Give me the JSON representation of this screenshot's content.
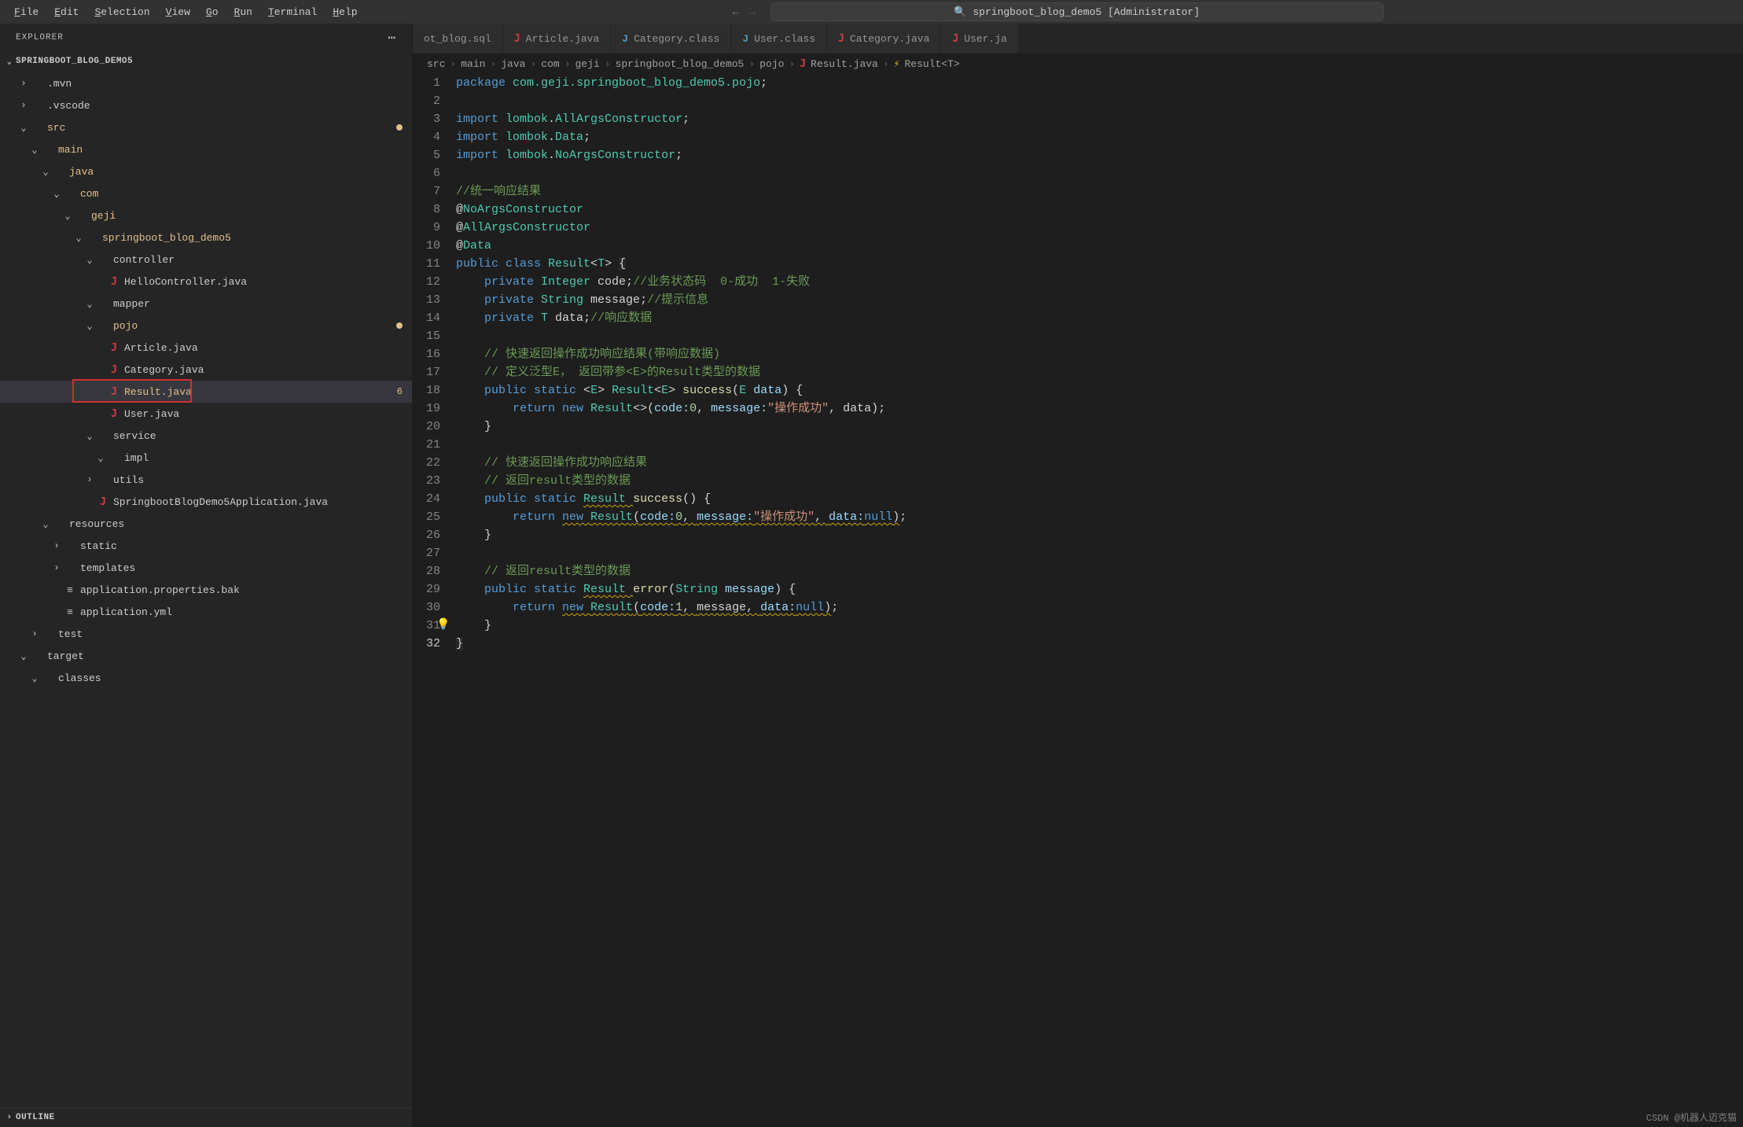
{
  "menubar": {
    "items": [
      {
        "pre": "",
        "mn": "F",
        "post": "ile"
      },
      {
        "pre": "",
        "mn": "E",
        "post": "dit"
      },
      {
        "pre": "",
        "mn": "S",
        "post": "election"
      },
      {
        "pre": "",
        "mn": "V",
        "post": "iew"
      },
      {
        "pre": "",
        "mn": "G",
        "post": "o"
      },
      {
        "pre": "",
        "mn": "R",
        "post": "un"
      },
      {
        "pre": "",
        "mn": "T",
        "post": "erminal"
      },
      {
        "pre": "",
        "mn": "H",
        "post": "elp"
      }
    ],
    "search_text": "springboot_blog_demo5 [Administrator]"
  },
  "explorer": {
    "title": "EXPLORER",
    "project": "SPRINGBOOT_BLOG_DEMO5",
    "outline": "OUTLINE",
    "tree": [
      {
        "indent": 1,
        "chev": "›",
        "label": ".mvn",
        "kind": "dir"
      },
      {
        "indent": 1,
        "chev": "›",
        "label": ".vscode",
        "kind": "dir"
      },
      {
        "indent": 1,
        "chev": "⌄",
        "label": "src",
        "kind": "dir",
        "yellow": true,
        "dot": true
      },
      {
        "indent": 2,
        "chev": "⌄",
        "label": "main",
        "kind": "dir",
        "yellow": true
      },
      {
        "indent": 3,
        "chev": "⌄",
        "label": "java",
        "kind": "dir",
        "yellow": true
      },
      {
        "indent": 4,
        "chev": "⌄",
        "label": "com",
        "kind": "dir",
        "yellow": true
      },
      {
        "indent": 5,
        "chev": "⌄",
        "label": "geji",
        "kind": "dir",
        "yellow": true
      },
      {
        "indent": 6,
        "chev": "⌄",
        "label": "springboot_blog_demo5",
        "kind": "dir",
        "yellow": true
      },
      {
        "indent": 7,
        "chev": "⌄",
        "label": "controller",
        "kind": "dir"
      },
      {
        "indent": 8,
        "chev": "",
        "label": "HelloController.java",
        "kind": "java"
      },
      {
        "indent": 7,
        "chev": "⌄",
        "label": "mapper",
        "kind": "dir"
      },
      {
        "indent": 7,
        "chev": "⌄",
        "label": "pojo",
        "kind": "dir",
        "yellow": true,
        "dot": true
      },
      {
        "indent": 8,
        "chev": "",
        "label": "Article.java",
        "kind": "java"
      },
      {
        "indent": 8,
        "chev": "",
        "label": "Category.java",
        "kind": "java"
      },
      {
        "indent": 8,
        "chev": "",
        "label": "Result.java",
        "kind": "java",
        "yellow": true,
        "active": true,
        "badge": "6",
        "redbox": true
      },
      {
        "indent": 8,
        "chev": "",
        "label": "User.java",
        "kind": "java"
      },
      {
        "indent": 7,
        "chev": "⌄",
        "label": "service",
        "kind": "dir"
      },
      {
        "indent": 8,
        "chev": "⌄",
        "label": "impl",
        "kind": "dir"
      },
      {
        "indent": 7,
        "chev": "›",
        "label": "utils",
        "kind": "dir"
      },
      {
        "indent": 7,
        "chev": "",
        "label": "SpringbootBlogDemo5Application.java",
        "kind": "java"
      },
      {
        "indent": 3,
        "chev": "⌄",
        "label": "resources",
        "kind": "dir"
      },
      {
        "indent": 4,
        "chev": "›",
        "label": "static",
        "kind": "dir"
      },
      {
        "indent": 4,
        "chev": "›",
        "label": "templates",
        "kind": "dir"
      },
      {
        "indent": 4,
        "chev": "",
        "label": "application.properties.bak",
        "kind": "file"
      },
      {
        "indent": 4,
        "chev": "",
        "label": "application.yml",
        "kind": "file"
      },
      {
        "indent": 2,
        "chev": "›",
        "label": "test",
        "kind": "dir"
      },
      {
        "indent": 1,
        "chev": "⌄",
        "label": "target",
        "kind": "dir"
      },
      {
        "indent": 2,
        "chev": "⌄",
        "label": "classes",
        "kind": "dir"
      }
    ]
  },
  "tabs": [
    {
      "label": "ot_blog.sql",
      "icon": ""
    },
    {
      "label": "Article.java",
      "icon": "J"
    },
    {
      "label": "Category.class",
      "icon": "C"
    },
    {
      "label": "User.class",
      "icon": "C"
    },
    {
      "label": "Category.java",
      "icon": "J"
    },
    {
      "label": "User.ja",
      "icon": "J"
    }
  ],
  "breadcrumb": [
    "src",
    "main",
    "java",
    "com",
    "geji",
    "springboot_blog_demo5",
    "pojo",
    "Result.java",
    "Result<T>"
  ],
  "code": {
    "lines": [
      {
        "n": 1,
        "tokens": [
          {
            "t": "package ",
            "c": "tok-kw"
          },
          {
            "t": "com.geji.springboot_blog_demo5.pojo",
            "c": "tok-type"
          },
          {
            "t": ";",
            "c": ""
          }
        ]
      },
      {
        "n": 2,
        "tokens": []
      },
      {
        "n": 3,
        "tokens": [
          {
            "t": "import ",
            "c": "tok-kw"
          },
          {
            "t": "lombok",
            "c": "tok-type"
          },
          {
            "t": ".",
            "c": ""
          },
          {
            "t": "AllArgsConstructor",
            "c": "tok-type"
          },
          {
            "t": ";",
            "c": ""
          }
        ]
      },
      {
        "n": 4,
        "tokens": [
          {
            "t": "import ",
            "c": "tok-kw"
          },
          {
            "t": "lombok",
            "c": "tok-type"
          },
          {
            "t": ".",
            "c": ""
          },
          {
            "t": "Data",
            "c": "tok-type"
          },
          {
            "t": ";",
            "c": ""
          }
        ]
      },
      {
        "n": 5,
        "tokens": [
          {
            "t": "import ",
            "c": "tok-kw"
          },
          {
            "t": "lombok",
            "c": "tok-type"
          },
          {
            "t": ".",
            "c": ""
          },
          {
            "t": "NoArgsConstructor",
            "c": "tok-type"
          },
          {
            "t": ";",
            "c": ""
          }
        ]
      },
      {
        "n": 6,
        "tokens": []
      },
      {
        "n": 7,
        "tokens": [
          {
            "t": "//统一响应结果",
            "c": "tok-comment"
          }
        ]
      },
      {
        "n": 8,
        "tokens": [
          {
            "t": "@",
            "c": ""
          },
          {
            "t": "NoArgsConstructor",
            "c": "tok-anno"
          }
        ]
      },
      {
        "n": 9,
        "tokens": [
          {
            "t": "@",
            "c": ""
          },
          {
            "t": "AllArgsConstructor",
            "c": "tok-anno"
          }
        ]
      },
      {
        "n": 10,
        "tokens": [
          {
            "t": "@",
            "c": ""
          },
          {
            "t": "Data",
            "c": "tok-anno"
          }
        ]
      },
      {
        "n": 11,
        "tokens": [
          {
            "t": "public ",
            "c": "tok-kw"
          },
          {
            "t": "class ",
            "c": "tok-kw"
          },
          {
            "t": "Result",
            "c": "tok-type"
          },
          {
            "t": "<",
            "c": ""
          },
          {
            "t": "T",
            "c": "tok-type"
          },
          {
            "t": "> ",
            "c": ""
          },
          {
            "t": "{",
            "c": "cursor-line"
          }
        ]
      },
      {
        "n": 12,
        "tokens": [
          {
            "t": "    ",
            "c": ""
          },
          {
            "t": "private ",
            "c": "tok-kw"
          },
          {
            "t": "Integer ",
            "c": "tok-type"
          },
          {
            "t": "code",
            "c": ""
          },
          {
            "t": ";",
            "c": ""
          },
          {
            "t": "//业务状态码  0-成功  1-失败",
            "c": "tok-comment"
          }
        ]
      },
      {
        "n": 13,
        "tokens": [
          {
            "t": "    ",
            "c": ""
          },
          {
            "t": "private ",
            "c": "tok-kw"
          },
          {
            "t": "String ",
            "c": "tok-type"
          },
          {
            "t": "message",
            "c": ""
          },
          {
            "t": ";",
            "c": ""
          },
          {
            "t": "//提示信息",
            "c": "tok-comment"
          }
        ]
      },
      {
        "n": 14,
        "tokens": [
          {
            "t": "    ",
            "c": ""
          },
          {
            "t": "private ",
            "c": "tok-kw"
          },
          {
            "t": "T ",
            "c": "tok-type"
          },
          {
            "t": "data",
            "c": ""
          },
          {
            "t": ";",
            "c": ""
          },
          {
            "t": "//响应数据",
            "c": "tok-comment"
          }
        ]
      },
      {
        "n": 15,
        "tokens": []
      },
      {
        "n": 16,
        "tokens": [
          {
            "t": "    ",
            "c": ""
          },
          {
            "t": "// 快速返回操作成功响应结果(带响应数据)",
            "c": "tok-comment"
          }
        ]
      },
      {
        "n": 17,
        "tokens": [
          {
            "t": "    ",
            "c": ""
          },
          {
            "t": "// 定义泛型E， 返回带参<E>的Result类型的数据",
            "c": "tok-comment"
          }
        ]
      },
      {
        "n": 18,
        "tokens": [
          {
            "t": "    ",
            "c": ""
          },
          {
            "t": "public ",
            "c": "tok-kw"
          },
          {
            "t": "static ",
            "c": "tok-kw"
          },
          {
            "t": "<",
            "c": ""
          },
          {
            "t": "E",
            "c": "tok-type"
          },
          {
            "t": "> ",
            "c": ""
          },
          {
            "t": "Result",
            "c": "tok-type"
          },
          {
            "t": "<",
            "c": ""
          },
          {
            "t": "E",
            "c": "tok-type"
          },
          {
            "t": "> ",
            "c": ""
          },
          {
            "t": "success",
            "c": "tok-func"
          },
          {
            "t": "(",
            "c": ""
          },
          {
            "t": "E ",
            "c": "tok-type"
          },
          {
            "t": "data",
            "c": "tok-paramname"
          },
          {
            "t": ") {",
            "c": ""
          }
        ]
      },
      {
        "n": 19,
        "tokens": [
          {
            "t": "        ",
            "c": ""
          },
          {
            "t": "return ",
            "c": "tok-kw"
          },
          {
            "t": "new ",
            "c": "tok-kw"
          },
          {
            "t": "Result",
            "c": "tok-type"
          },
          {
            "t": "<>(",
            "c": ""
          },
          {
            "t": "code:",
            "c": "tok-paramname"
          },
          {
            "t": "0",
            "c": "tok-num"
          },
          {
            "t": ", ",
            "c": ""
          },
          {
            "t": "message:",
            "c": "tok-paramname"
          },
          {
            "t": "\"操作成功\"",
            "c": "tok-str"
          },
          {
            "t": ", data);",
            "c": ""
          }
        ]
      },
      {
        "n": 20,
        "tokens": [
          {
            "t": "    }",
            "c": ""
          }
        ]
      },
      {
        "n": 21,
        "tokens": []
      },
      {
        "n": 22,
        "tokens": [
          {
            "t": "    ",
            "c": ""
          },
          {
            "t": "// 快速返回操作成功响应结果",
            "c": "tok-comment"
          }
        ]
      },
      {
        "n": 23,
        "tokens": [
          {
            "t": "    ",
            "c": ""
          },
          {
            "t": "// 返回result类型的数据",
            "c": "tok-comment"
          }
        ]
      },
      {
        "n": 24,
        "tokens": [
          {
            "t": "    ",
            "c": ""
          },
          {
            "t": "public ",
            "c": "tok-kw"
          },
          {
            "t": "static ",
            "c": "tok-kw"
          },
          {
            "t": "Result ",
            "c": "tok-type wavy"
          },
          {
            "t": "success",
            "c": "tok-func"
          },
          {
            "t": "() {",
            "c": ""
          }
        ]
      },
      {
        "n": 25,
        "tokens": [
          {
            "t": "        ",
            "c": ""
          },
          {
            "t": "return ",
            "c": "tok-kw"
          },
          {
            "t": "new ",
            "c": "tok-kw wavy"
          },
          {
            "t": "Result",
            "c": "tok-type wavy"
          },
          {
            "t": "(",
            "c": "wavy"
          },
          {
            "t": "code:",
            "c": "tok-paramname wavy"
          },
          {
            "t": "0",
            "c": "tok-num wavy"
          },
          {
            "t": ", ",
            "c": "wavy"
          },
          {
            "t": "message:",
            "c": "tok-paramname wavy"
          },
          {
            "t": "\"操作成功\"",
            "c": "tok-str wavy"
          },
          {
            "t": ", ",
            "c": "wavy"
          },
          {
            "t": "data:",
            "c": "tok-paramname wavy"
          },
          {
            "t": "null",
            "c": "tok-kw wavy"
          },
          {
            "t": ")",
            "c": "wavy"
          },
          {
            "t": ";",
            "c": ""
          }
        ]
      },
      {
        "n": 26,
        "tokens": [
          {
            "t": "    }",
            "c": ""
          }
        ]
      },
      {
        "n": 27,
        "tokens": []
      },
      {
        "n": 28,
        "tokens": [
          {
            "t": "    ",
            "c": ""
          },
          {
            "t": "// 返回result类型的数据",
            "c": "tok-comment"
          }
        ]
      },
      {
        "n": 29,
        "tokens": [
          {
            "t": "    ",
            "c": ""
          },
          {
            "t": "public ",
            "c": "tok-kw"
          },
          {
            "t": "static ",
            "c": "tok-kw"
          },
          {
            "t": "Result ",
            "c": "tok-type wavy"
          },
          {
            "t": "error",
            "c": "tok-func"
          },
          {
            "t": "(",
            "c": ""
          },
          {
            "t": "String ",
            "c": "tok-type"
          },
          {
            "t": "message",
            "c": "tok-paramname"
          },
          {
            "t": ") {",
            "c": ""
          }
        ]
      },
      {
        "n": 30,
        "tokens": [
          {
            "t": "        ",
            "c": ""
          },
          {
            "t": "return ",
            "c": "tok-kw"
          },
          {
            "t": "new ",
            "c": "tok-kw wavy"
          },
          {
            "t": "Result",
            "c": "tok-type wavy"
          },
          {
            "t": "(",
            "c": "wavy"
          },
          {
            "t": "code:",
            "c": "tok-paramname wavy"
          },
          {
            "t": "1",
            "c": "tok-num wavy"
          },
          {
            "t": ", ",
            "c": "wavy"
          },
          {
            "t": "message",
            "c": "wavy"
          },
          {
            "t": ", ",
            "c": "wavy"
          },
          {
            "t": "data:",
            "c": "tok-paramname wavy"
          },
          {
            "t": "null",
            "c": "tok-kw wavy"
          },
          {
            "t": ")",
            "c": "wavy"
          },
          {
            "t": ";",
            "c": ""
          }
        ]
      },
      {
        "n": 31,
        "tokens": [
          {
            "t": "    }",
            "c": ""
          }
        ],
        "bulb": true
      },
      {
        "n": 32,
        "tokens": [
          {
            "t": "}",
            "c": "cursor-line"
          }
        ],
        "current": true
      }
    ]
  },
  "watermark": "CSDN @机器人迈克猫"
}
